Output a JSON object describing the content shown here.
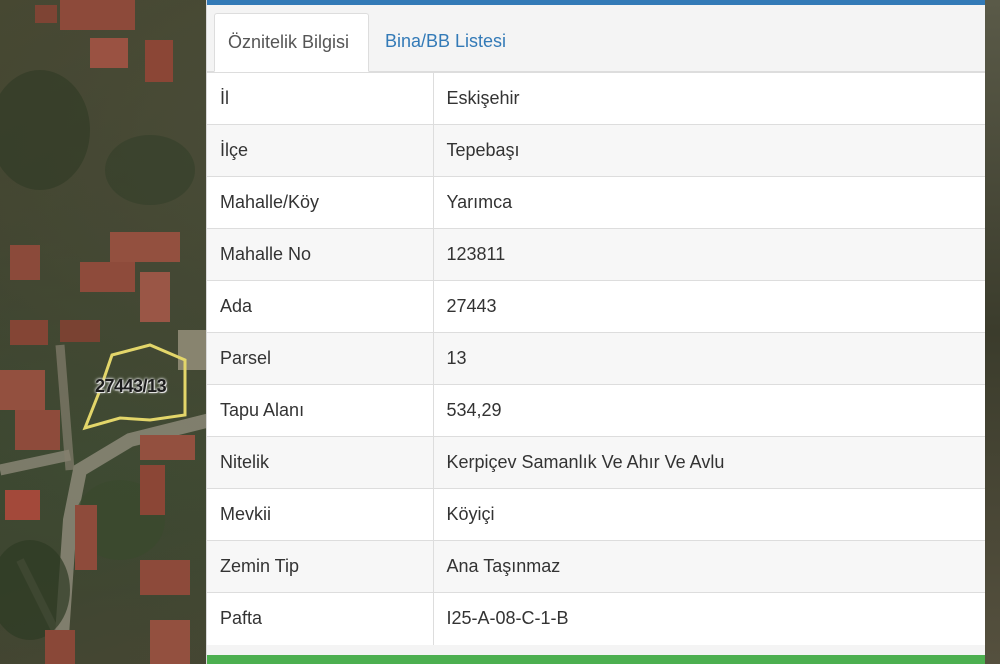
{
  "map": {
    "parcel_label": "27443/13"
  },
  "tabs": [
    {
      "label": "Öznitelik Bilgisi",
      "active": true
    },
    {
      "label": "Bina/BB Listesi",
      "active": false
    }
  ],
  "attributes": [
    {
      "key": "İl",
      "value": "Eskişehir"
    },
    {
      "key": "İlçe",
      "value": "Tepebaşı"
    },
    {
      "key": "Mahalle/Köy",
      "value": "Yarımca"
    },
    {
      "key": "Mahalle No",
      "value": "123811"
    },
    {
      "key": "Ada",
      "value": "27443"
    },
    {
      "key": "Parsel",
      "value": "13"
    },
    {
      "key": "Tapu Alanı",
      "value": "534,29"
    },
    {
      "key": "Nitelik",
      "value": "Kerpiçev Samanlık Ve Ahır Ve Avlu"
    },
    {
      "key": "Mevkii",
      "value": "Köyiçi"
    },
    {
      "key": "Zemin Tip",
      "value": "Ana Taşınmaz"
    },
    {
      "key": "Pafta",
      "value": "I25-A-08-C-1-B"
    }
  ],
  "colors": {
    "accent": "#337ab7",
    "bottom_bar": "#4caf50",
    "parcel_outline": "#e3d66a"
  }
}
